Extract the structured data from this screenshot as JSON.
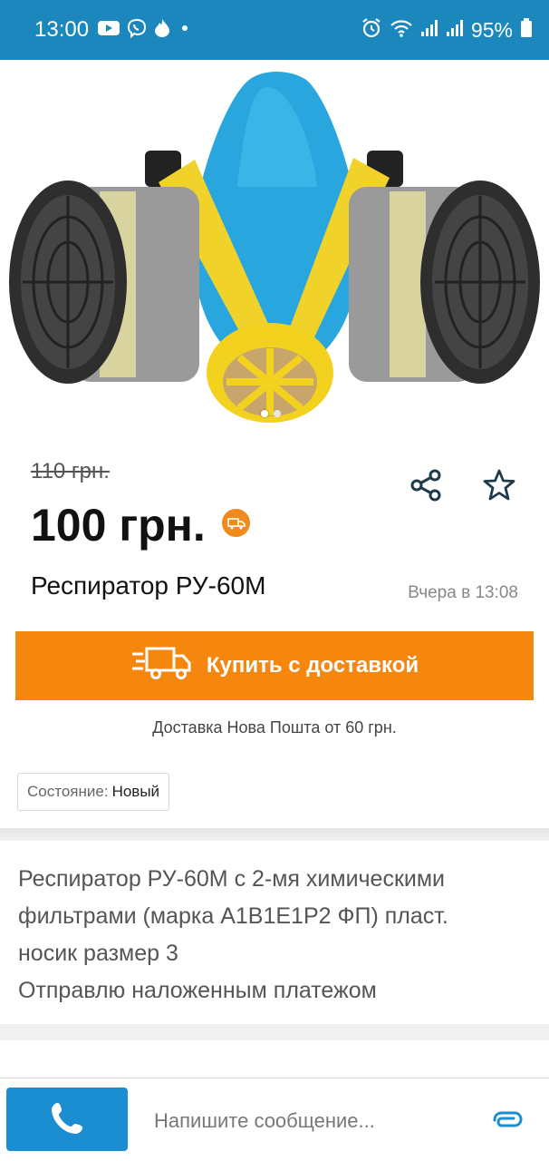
{
  "status_bar": {
    "time": "13:00",
    "battery": "95%",
    "icons": [
      "youtube-icon",
      "viber-icon",
      "flame-icon",
      "dot-icon",
      "alarm-icon",
      "wifi-icon",
      "signal-icon",
      "signal-icon",
      "battery-icon"
    ]
  },
  "gallery": {
    "image_name": "respirator-photo",
    "page": 1,
    "total_pages": 2
  },
  "listing": {
    "old_price": "110 грн.",
    "price": "100 грн.",
    "title": "Респиратор РУ-60М",
    "date": "Вчера в 13:08"
  },
  "buy": {
    "label": "Купить с доставкой"
  },
  "delivery_note": "Доставка Нова Пошта от 60 грн.",
  "condition": {
    "label": "Состояние:",
    "value": "Новый"
  },
  "description": {
    "lines": [
      "Респиратор РУ-60М с 2-мя химическими",
      "фильтрами (марка А1В1Е1Р2 ФП) пласт.",
      "носик размер 3",
      "Отправлю наложенным платежом"
    ]
  },
  "message": {
    "placeholder": "Напишите сообщение..."
  },
  "colors": {
    "status_bar": "#1b87bd",
    "accent_orange": "#f5870f",
    "call_blue": "#1b8ed2",
    "icon_dark": "#1e3a4c"
  }
}
